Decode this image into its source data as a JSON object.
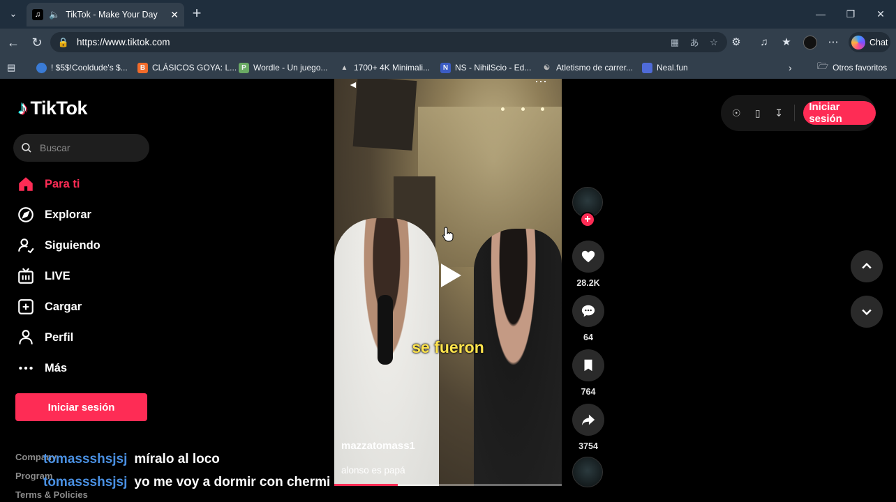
{
  "browser": {
    "tab": {
      "title": "TikTok - Make Your Day"
    },
    "address": {
      "url": "https://www.tiktok.com"
    },
    "chat_label": "Chat",
    "bookmarks": [
      {
        "label": "! $5$!Cooldude's $...",
        "color": "#3a7bd5"
      },
      {
        "label": "CLÁSICOS GOYA: L...",
        "color": "#f26b2a"
      },
      {
        "label": "Wordle - Un juego...",
        "color": "#6aaa64"
      },
      {
        "label": "1700+ 4K Minimali...",
        "color": "#cfcfcf"
      },
      {
        "label": "NS - NihilScio - Ed...",
        "color": "#3b5cc4"
      },
      {
        "label": "Atletismo de carrer...",
        "color": "#888888"
      },
      {
        "label": "Neal.fun",
        "color": "#4f6bd8"
      }
    ],
    "other_favorites": "Otros favoritos"
  },
  "tiktok": {
    "logo": "TikTok",
    "search_placeholder": "Buscar",
    "nav": [
      {
        "label": "Para ti",
        "icon": "home-icon",
        "active": true
      },
      {
        "label": "Explorar",
        "icon": "compass-icon",
        "active": false
      },
      {
        "label": "Siguiendo",
        "icon": "following-icon",
        "active": false
      },
      {
        "label": "LIVE",
        "icon": "live-icon",
        "active": false
      },
      {
        "label": "Cargar",
        "icon": "upload-icon",
        "active": false
      },
      {
        "label": "Perfil",
        "icon": "profile-icon",
        "active": false
      },
      {
        "label": "Más",
        "icon": "more-icon",
        "active": false
      }
    ],
    "login_button": "Iniciar sesión",
    "footer": [
      "Company",
      "Program",
      "Terms & Policies"
    ],
    "top_right_login": "Iniciar sesión",
    "video": {
      "caption": "se fueron",
      "author": "mazzatomass1",
      "description": "alonso es papá",
      "progress": 0.28
    },
    "actions": {
      "likes": "28.2K",
      "comments": "64",
      "saves": "764",
      "shares": "3754"
    }
  },
  "chat_overlay": [
    {
      "user": "tomassshsjsj",
      "message": "míralo al loco"
    },
    {
      "user": "tomassshsjsj",
      "message": "yo me voy a dormir con chermi"
    }
  ],
  "colors": {
    "brand": "#fe2c55",
    "chat_user": "#4a90e2",
    "caption": "#ffe44d",
    "browser_frame": "#323f4c"
  }
}
